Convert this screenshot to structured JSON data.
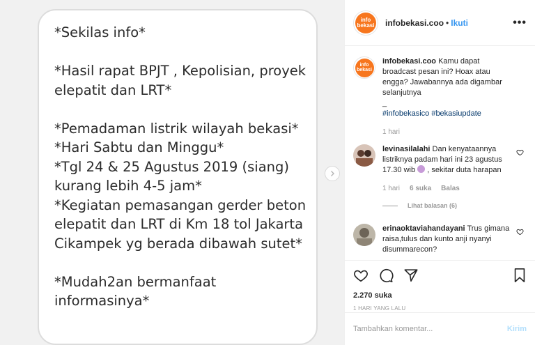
{
  "image_text": "*Sekilas info*\n\n*Hasil rapat BPJT , Kepolisian, proyek elepatit dan LRT*\n\n*Pemadaman listrik wilayah bekasi*\n*Hari Sabtu dan Minggu*\n*Tgl 24 & 25 Agustus 2019 (siang) kurang lebih 4-5 jam*\n*Kegiatan pemasangan gerder beton elepatit dan LRT di Km 18 tol Jakarta Cikampek yg berada dibawah sutet*\n\n*Mudah2an bermanfaat informasinya*",
  "header": {
    "avatar_text_top": "info",
    "avatar_text_bottom": "bekasi",
    "username": "infobekasi.coo",
    "dot": "•",
    "follow": "Ikuti",
    "more": "•••"
  },
  "caption": {
    "username": "infobekasi.coo",
    "text": "Kamu dapat broadcast pesan ini? Hoax atau engga? Jawabannya ada digambar selanjutnya",
    "underscore": "_",
    "hashtags": "#infobekasico #bekasiupdate",
    "time": "1 hari"
  },
  "comments": [
    {
      "username": "levinasilalahi",
      "text": "Dan kenyataannya listriknya padam hari ini 23 agustus 17.30 wib",
      "text_after": ", sekitar duta harapan",
      "time": "1 hari",
      "likes": "6 suka",
      "reply": "Balas",
      "view_replies": "Lihat balasan (6)"
    },
    {
      "username": "erinaoktaviahandayani",
      "text": "Trus gimana raisa,tulus dan kunto anji nyanyi disummarecon?"
    }
  ],
  "likes_count": "2.270 suka",
  "post_date": "1 HARI YANG LALU",
  "comment_input": {
    "placeholder": "Tambahkan komentar...",
    "post_label": "Kirim"
  },
  "colors": {
    "accent": "#3897f0",
    "avatar_bg": "#f7761e",
    "hashtag": "#003569"
  }
}
